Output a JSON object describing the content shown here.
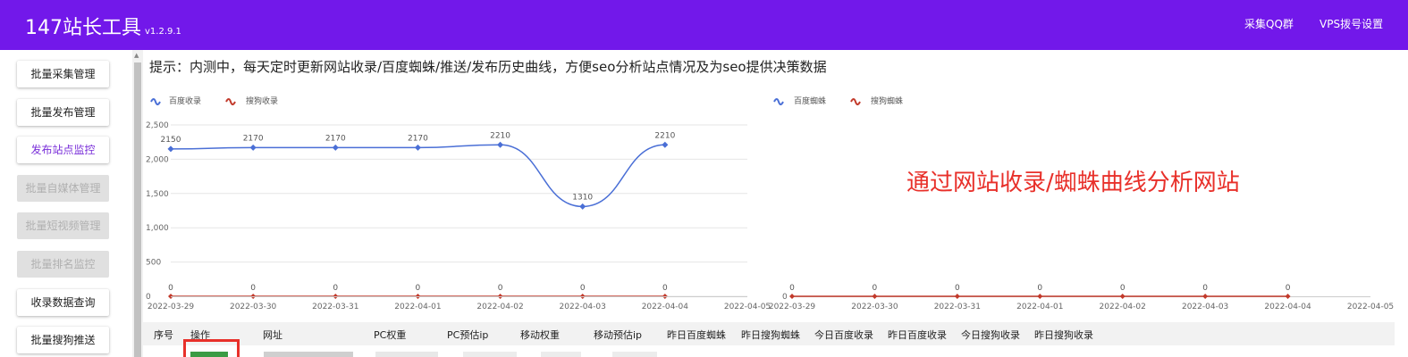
{
  "header": {
    "brand": "147站长工具",
    "version": "v1.2.9.1",
    "qq_group": "采集QQ群",
    "vps_setting": "VPS拨号设置"
  },
  "sidebar": {
    "items": [
      {
        "label": "批量采集管理",
        "state": "normal"
      },
      {
        "label": "批量发布管理",
        "state": "normal"
      },
      {
        "label": "发布站点监控",
        "state": "active"
      },
      {
        "label": "批量自媒体管理",
        "state": "disabled"
      },
      {
        "label": "批量短视频管理",
        "state": "disabled"
      },
      {
        "label": "批量排名监控",
        "state": "disabled"
      },
      {
        "label": "收录数据查询",
        "state": "normal"
      },
      {
        "label": "批量搜狗推送",
        "state": "normal"
      }
    ]
  },
  "hint": "提示：内测中，每天定时更新网站收录/百度蜘蛛/推送/发布历史曲线，方便seo分析站点情况及为seo提供决策数据",
  "overlay_note": "通过网站收录/蜘蛛曲线分析网站",
  "colors": {
    "brand": "#7218ea",
    "baidu_series": "#4a6fd6",
    "sogou_series": "#c23a2b",
    "annotation": "#e8302a",
    "active_nav": "#7a2fd9"
  },
  "chart_data": [
    {
      "type": "line",
      "x": [
        "2022-03-29",
        "2022-03-30",
        "2022-03-31",
        "2022-04-01",
        "2022-04-02",
        "2022-04-03",
        "2022-04-04",
        "2022-04-05"
      ],
      "yticks": [
        "0",
        "500",
        "1,000",
        "1,500",
        "2,000",
        "2,500"
      ],
      "ylim": [
        0,
        2500
      ],
      "series": [
        {
          "name": "百度收录",
          "color": "#4a6fd6",
          "values": [
            2150,
            2170,
            2170,
            2170,
            2210,
            1310,
            2210
          ],
          "labels": [
            "2150",
            "2170",
            "2170",
            "2170",
            "2210",
            "1310",
            "2210"
          ]
        },
        {
          "name": "搜狗收录",
          "color": "#c23a2b",
          "values": [
            0,
            0,
            0,
            0,
            0,
            0,
            0
          ],
          "labels": [
            "0",
            "0",
            "0",
            "0",
            "0",
            "0",
            "0"
          ]
        }
      ],
      "grid": true,
      "legend": "top-left"
    },
    {
      "type": "line",
      "x": [
        "2022-03-29",
        "2022-03-30",
        "2022-03-31",
        "2022-04-01",
        "2022-04-02",
        "2022-04-03",
        "2022-04-04",
        "2022-04-05"
      ],
      "yticks": [
        "0"
      ],
      "series": [
        {
          "name": "百度蜘蛛",
          "color": "#4a6fd6",
          "values": [],
          "labels": []
        },
        {
          "name": "搜狗蜘蛛",
          "color": "#c23a2b",
          "values": [
            0,
            0,
            0,
            0,
            0,
            0,
            0
          ],
          "labels": [
            "0",
            "0",
            "0",
            "0",
            "0",
            "0",
            "0"
          ]
        }
      ],
      "grid": false,
      "legend": "top-left"
    }
  ],
  "table": {
    "headers": [
      "序号",
      "操作",
      "网址",
      "PC权重",
      "PC预估ip",
      "移动权重",
      "移动预估ip",
      "昨日百度蜘蛛",
      "昨日搜狗蜘蛛",
      "今日百度收录",
      "昨日百度收录",
      "今日搜狗收录",
      "昨日搜狗收录"
    ]
  }
}
